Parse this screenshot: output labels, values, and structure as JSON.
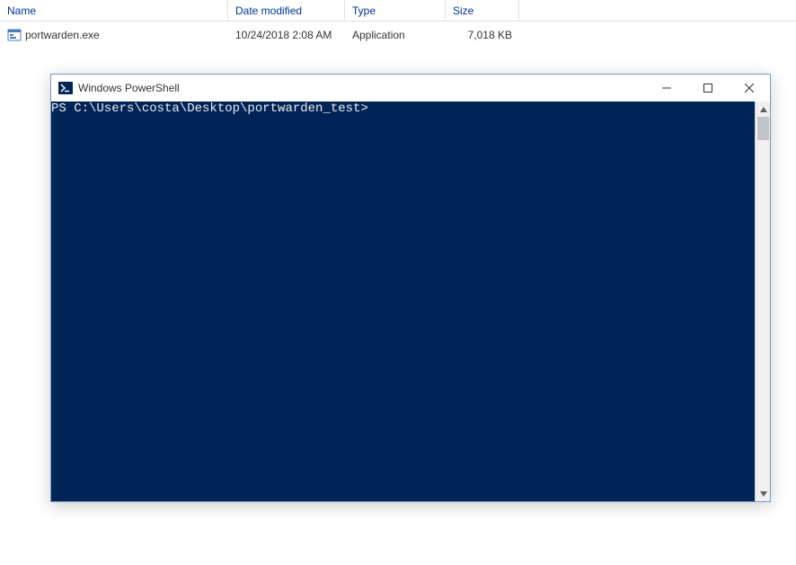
{
  "explorer": {
    "columns": {
      "name": "Name",
      "date": "Date modified",
      "type": "Type",
      "size": "Size"
    },
    "rows": [
      {
        "name": "portwarden.exe",
        "date": "10/24/2018 2:08 AM",
        "type": "Application",
        "size": "7,018 KB"
      }
    ]
  },
  "powershell": {
    "title": "Windows PowerShell",
    "prompt": "PS C:\\Users\\costa\\Desktop\\portwarden_test>"
  }
}
